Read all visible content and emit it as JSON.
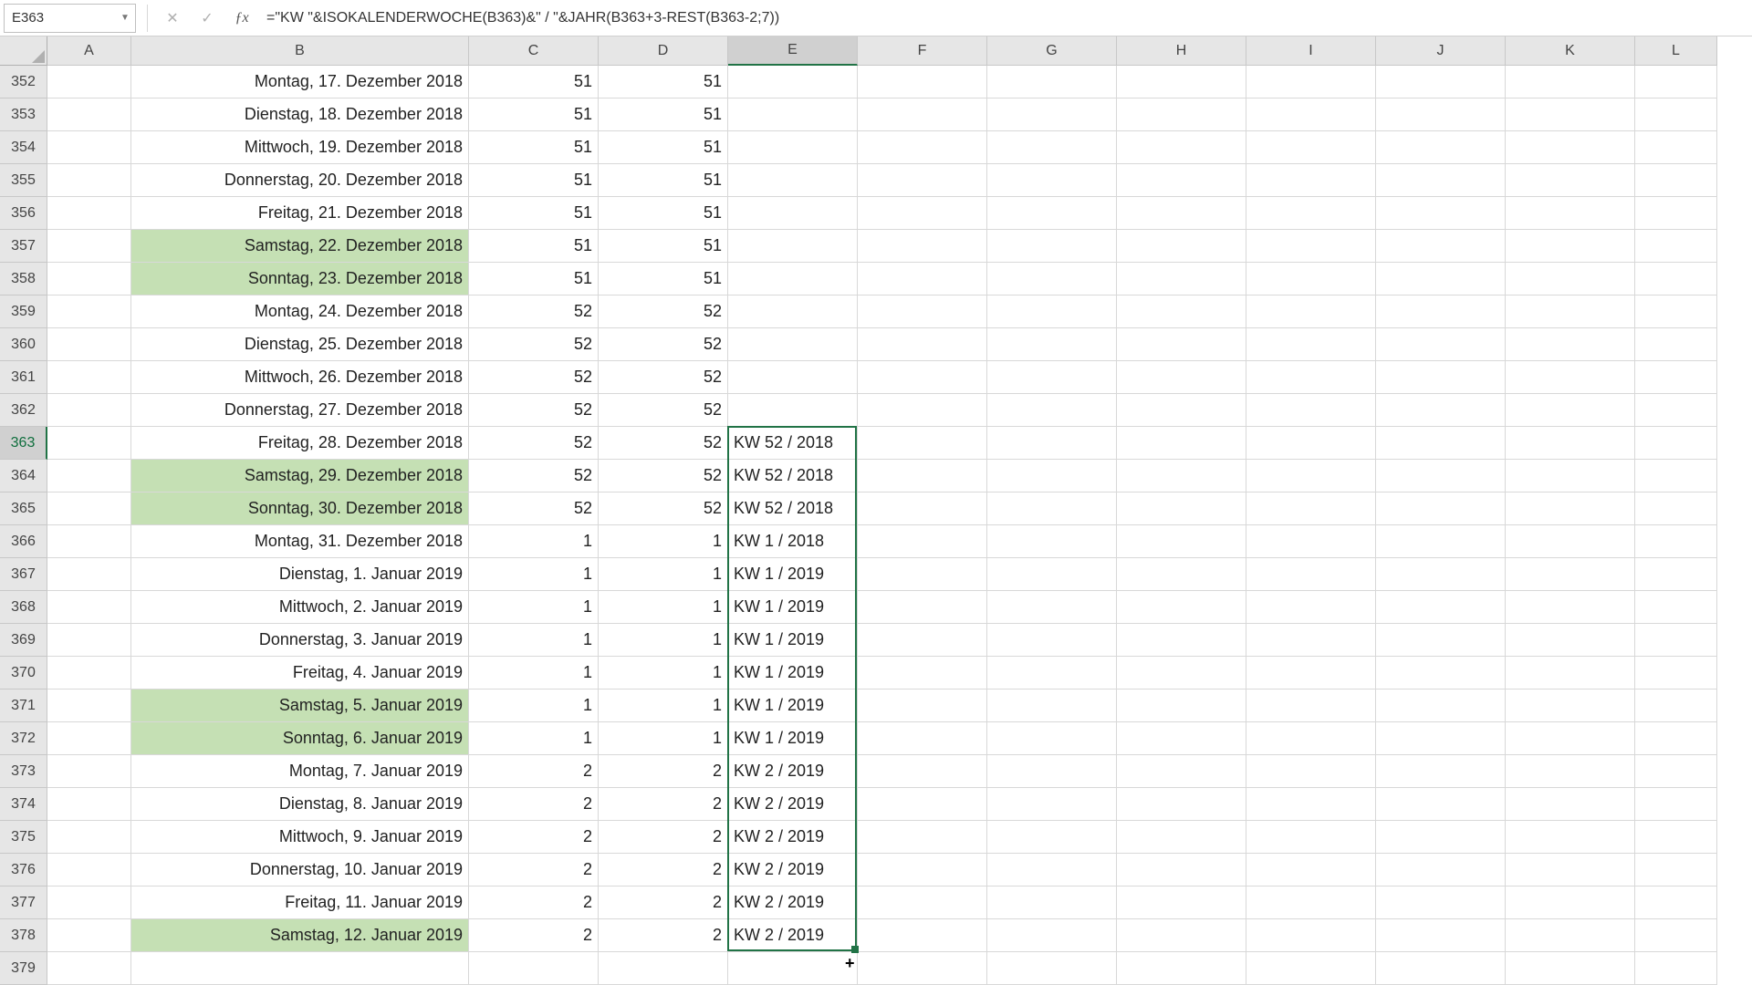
{
  "name_box": "E363",
  "formula": "=\"KW \"&ISOKALENDERWOCHE(B363)&\" / \"&JAHR(B363+3-REST(B363-2;7))",
  "columns": [
    "A",
    "B",
    "C",
    "D",
    "E",
    "F",
    "G",
    "H",
    "I",
    "J",
    "K",
    "L"
  ],
  "active_col_index": 4,
  "active_row_num": 363,
  "selection": {
    "first_row": 363,
    "last_row": 378,
    "col_index": 4
  },
  "rows": [
    {
      "n": 352,
      "b": "Montag, 17. Dezember 2018",
      "c": "51",
      "d": "51",
      "e": "",
      "wk": false
    },
    {
      "n": 353,
      "b": "Dienstag, 18. Dezember 2018",
      "c": "51",
      "d": "51",
      "e": "",
      "wk": false
    },
    {
      "n": 354,
      "b": "Mittwoch, 19. Dezember 2018",
      "c": "51",
      "d": "51",
      "e": "",
      "wk": false
    },
    {
      "n": 355,
      "b": "Donnerstag, 20. Dezember 2018",
      "c": "51",
      "d": "51",
      "e": "",
      "wk": false
    },
    {
      "n": 356,
      "b": "Freitag, 21. Dezember 2018",
      "c": "51",
      "d": "51",
      "e": "",
      "wk": false
    },
    {
      "n": 357,
      "b": "Samstag, 22. Dezember 2018",
      "c": "51",
      "d": "51",
      "e": "",
      "wk": true
    },
    {
      "n": 358,
      "b": "Sonntag, 23. Dezember 2018",
      "c": "51",
      "d": "51",
      "e": "",
      "wk": true
    },
    {
      "n": 359,
      "b": "Montag, 24. Dezember 2018",
      "c": "52",
      "d": "52",
      "e": "",
      "wk": false
    },
    {
      "n": 360,
      "b": "Dienstag, 25. Dezember 2018",
      "c": "52",
      "d": "52",
      "e": "",
      "wk": false
    },
    {
      "n": 361,
      "b": "Mittwoch, 26. Dezember 2018",
      "c": "52",
      "d": "52",
      "e": "",
      "wk": false
    },
    {
      "n": 362,
      "b": "Donnerstag, 27. Dezember 2018",
      "c": "52",
      "d": "52",
      "e": "",
      "wk": false
    },
    {
      "n": 363,
      "b": "Freitag, 28. Dezember 2018",
      "c": "52",
      "d": "52",
      "e": "KW 52 / 2018",
      "wk": false
    },
    {
      "n": 364,
      "b": "Samstag, 29. Dezember 2018",
      "c": "52",
      "d": "52",
      "e": "KW 52 / 2018",
      "wk": true
    },
    {
      "n": 365,
      "b": "Sonntag, 30. Dezember 2018",
      "c": "52",
      "d": "52",
      "e": "KW 52 / 2018",
      "wk": true
    },
    {
      "n": 366,
      "b": "Montag, 31. Dezember 2018",
      "c": "1",
      "d": "1",
      "e": "KW 1 / 2018",
      "wk": false
    },
    {
      "n": 367,
      "b": "Dienstag, 1. Januar 2019",
      "c": "1",
      "d": "1",
      "e": "KW 1 / 2019",
      "wk": false
    },
    {
      "n": 368,
      "b": "Mittwoch, 2. Januar 2019",
      "c": "1",
      "d": "1",
      "e": "KW 1 / 2019",
      "wk": false
    },
    {
      "n": 369,
      "b": "Donnerstag, 3. Januar 2019",
      "c": "1",
      "d": "1",
      "e": "KW 1 / 2019",
      "wk": false
    },
    {
      "n": 370,
      "b": "Freitag, 4. Januar 2019",
      "c": "1",
      "d": "1",
      "e": "KW 1 / 2019",
      "wk": false
    },
    {
      "n": 371,
      "b": "Samstag, 5. Januar 2019",
      "c": "1",
      "d": "1",
      "e": "KW 1 / 2019",
      "wk": true
    },
    {
      "n": 372,
      "b": "Sonntag, 6. Januar 2019",
      "c": "1",
      "d": "1",
      "e": "KW 1 / 2019",
      "wk": true
    },
    {
      "n": 373,
      "b": "Montag, 7. Januar 2019",
      "c": "2",
      "d": "2",
      "e": "KW 2 / 2019",
      "wk": false
    },
    {
      "n": 374,
      "b": "Dienstag, 8. Januar 2019",
      "c": "2",
      "d": "2",
      "e": "KW 2 / 2019",
      "wk": false
    },
    {
      "n": 375,
      "b": "Mittwoch, 9. Januar 2019",
      "c": "2",
      "d": "2",
      "e": "KW 2 / 2019",
      "wk": false
    },
    {
      "n": 376,
      "b": "Donnerstag, 10. Januar 2019",
      "c": "2",
      "d": "2",
      "e": "KW 2 / 2019",
      "wk": false
    },
    {
      "n": 377,
      "b": "Freitag, 11. Januar 2019",
      "c": "2",
      "d": "2",
      "e": "KW 2 / 2019",
      "wk": false
    },
    {
      "n": 378,
      "b": "Samstag, 12. Januar 2019",
      "c": "2",
      "d": "2",
      "e": "KW 2 / 2019",
      "wk": true
    },
    {
      "n": 379,
      "b": "",
      "c": "",
      "d": "",
      "e": "",
      "wk": false
    }
  ]
}
